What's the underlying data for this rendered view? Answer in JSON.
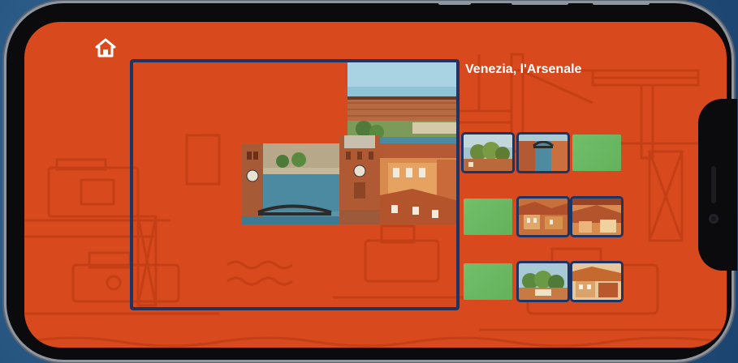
{
  "game": {
    "title": "Venezia, l'Arsenale",
    "image_subject": "Arsenale di Venezia"
  },
  "toolbar": {
    "home_icon": "home-icon"
  },
  "board": {
    "placed_pieces": [
      {
        "id": "sky-corner",
        "tile": "tile-sky-top"
      },
      {
        "id": "canal-left",
        "tile": "tile-canal-left"
      },
      {
        "id": "towers-center",
        "tile": "tile-towers"
      },
      {
        "id": "houses-right",
        "tile": "tile-houses-right"
      },
      {
        "id": "building-top-right",
        "tile": "tile-building"
      }
    ]
  },
  "tray": {
    "rows": [
      [
        {
          "state": "filled",
          "tile": "tile-trees"
        },
        {
          "state": "filled",
          "tile": "tile-canal-bridge"
        },
        {
          "state": "empty"
        }
      ],
      [
        {
          "state": "empty"
        },
        {
          "state": "filled",
          "tile": "tile-rooftops"
        },
        {
          "state": "filled",
          "tile": "tile-rooftops-2"
        }
      ],
      [
        {
          "state": "empty"
        },
        {
          "state": "filled",
          "tile": "tile-garden"
        },
        {
          "state": "filled",
          "tile": "tile-roofs-sun"
        }
      ]
    ]
  },
  "colors": {
    "screen_bg": "#d8491d",
    "frame_border": "#1e3563",
    "empty_slot": "#5ec96a",
    "title_text": "#ffffff"
  }
}
